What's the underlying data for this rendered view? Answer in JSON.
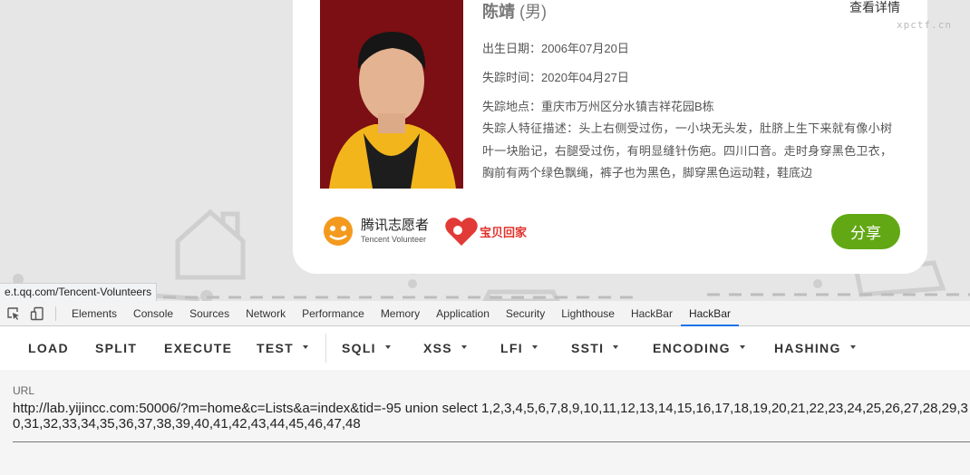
{
  "page": {
    "watermark": "xpctf.cn",
    "status_url": "e.t.qq.com/Tencent-Volunteers",
    "card": {
      "name": "陈靖",
      "gender": "(男)",
      "detail_link": "查看详情",
      "birth": "出生日期：2006年07月20日",
      "missing_time": "失踪时间：2020年04月27日",
      "missing_place": "失踪地点：重庆市万州区分水镇吉祥花园B栋",
      "description": "失踪人特征描述：头上右侧受过伤，一小块无头发，肚脐上生下来就有像小树叶一块胎记，右腿受过伤，有明显缝针伤疤。四川口音。走时身穿黑色卫衣，胸前有两个绿色飘绳，裤子也为黑色，脚穿黑色运动鞋，鞋底边",
      "logo_tencent_main": "腾讯志愿者",
      "logo_tencent_sub": "Tencent Volunteer",
      "logo_baobei": "宝贝回家",
      "share_label": "分享"
    }
  },
  "devtools": {
    "icons": [
      "inspect-icon",
      "device-toggle-icon"
    ],
    "tabs": [
      "Elements",
      "Console",
      "Sources",
      "Network",
      "Performance",
      "Memory",
      "Application",
      "Security",
      "Lighthouse",
      "HackBar",
      "HackBar"
    ],
    "active_tab_index": 10,
    "accent_color": "#1a73e8"
  },
  "hackbar": {
    "buttons": {
      "load": "LOAD",
      "split": "SPLIT",
      "execute": "EXECUTE",
      "test": "TEST",
      "sqli": "SQLI",
      "xss": "XSS",
      "lfi": "LFI",
      "ssti": "SSTI",
      "encoding": "ENCODING",
      "hashing": "HASHING"
    },
    "url_label": "URL",
    "url_value": "http://lab.yijincc.com:50006/?m=home&c=Lists&a=index&tid=-95 union select 1,2,3,4,5,6,7,8,9,10,11,12,13,14,15,16,17,18,19,20,21,22,23,24,25,26,27,28,29,30,31,32,33,34,35,36,37,38,39,40,41,42,43,44,45,46,47,48"
  }
}
